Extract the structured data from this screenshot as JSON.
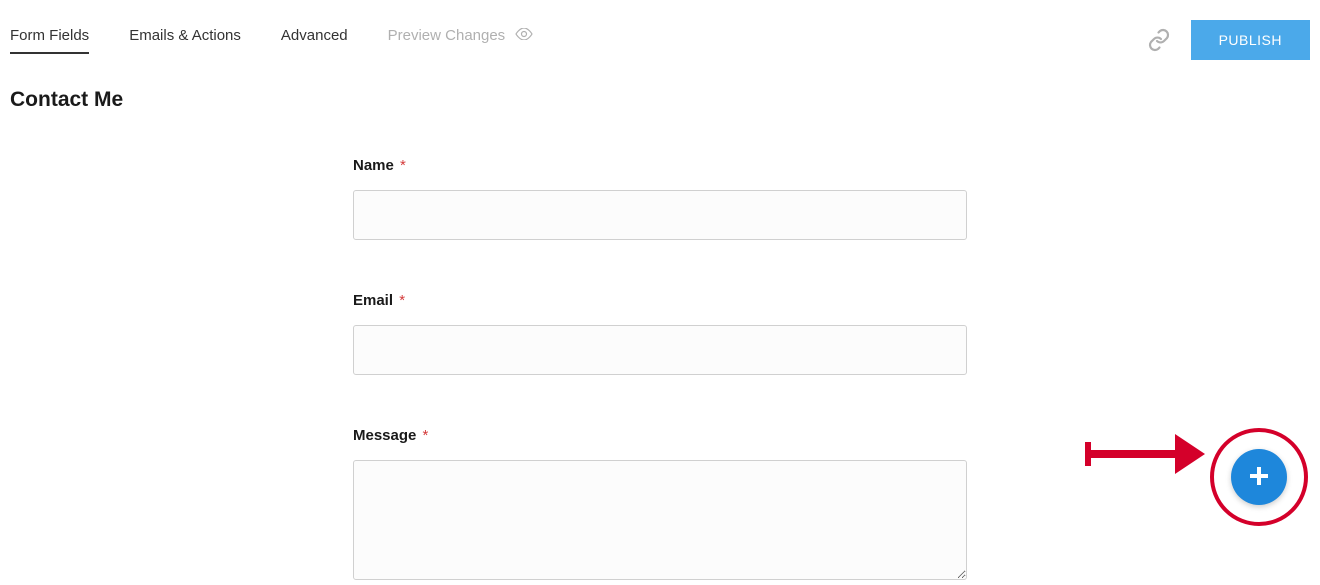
{
  "tabs": {
    "form_fields": "Form Fields",
    "emails_actions": "Emails & Actions",
    "advanced": "Advanced",
    "preview": "Preview Changes"
  },
  "actions": {
    "publish": "PUBLISH"
  },
  "page_title": "Contact Me",
  "fields": {
    "name": {
      "label": "Name",
      "required": "*"
    },
    "email": {
      "label": "Email",
      "required": "*"
    },
    "message": {
      "label": "Message",
      "required": "*"
    }
  }
}
